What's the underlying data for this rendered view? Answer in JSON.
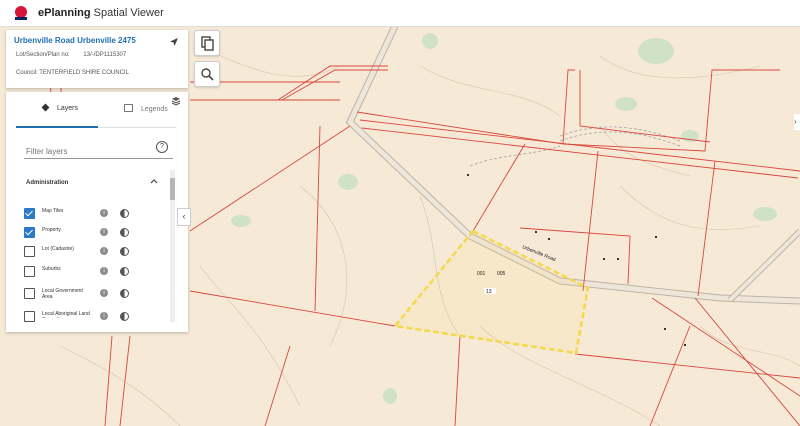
{
  "app": {
    "brand": "ePlanning",
    "title": "Spatial Viewer",
    "logo_text": "NSW"
  },
  "property": {
    "address": "Urbenville Road Urbenville 2475",
    "lot_label": "Lot/Section/Plan no:",
    "lot_value": "13/-/DP1115307",
    "council": "Council: TENTERFIELD SHIRE COUNCIL"
  },
  "panel": {
    "tabs": [
      {
        "label": "Layers"
      },
      {
        "label": "Legends"
      }
    ],
    "filter_placeholder": "Filter layers",
    "section_title": "Administration",
    "layers": [
      {
        "label": "Map Tiles",
        "checked": true
      },
      {
        "label": "Property",
        "checked": true
      },
      {
        "label": "Lot (Cadastre)",
        "checked": false
      },
      {
        "label": "Suburbs",
        "checked": false
      },
      {
        "label": "Local Government Area",
        "checked": false
      },
      {
        "label": "Local Aboriginal Land Council",
        "checked": false
      }
    ]
  },
  "map": {
    "road_label": "Urbenville Road",
    "lot_numbers": [
      "001",
      "005"
    ],
    "selected_lot": "13",
    "colors": {
      "background": "#f6ead7",
      "boundary": "#d9463e",
      "selection": "#f4d94a",
      "vegetation": "#cfe2c6"
    }
  }
}
